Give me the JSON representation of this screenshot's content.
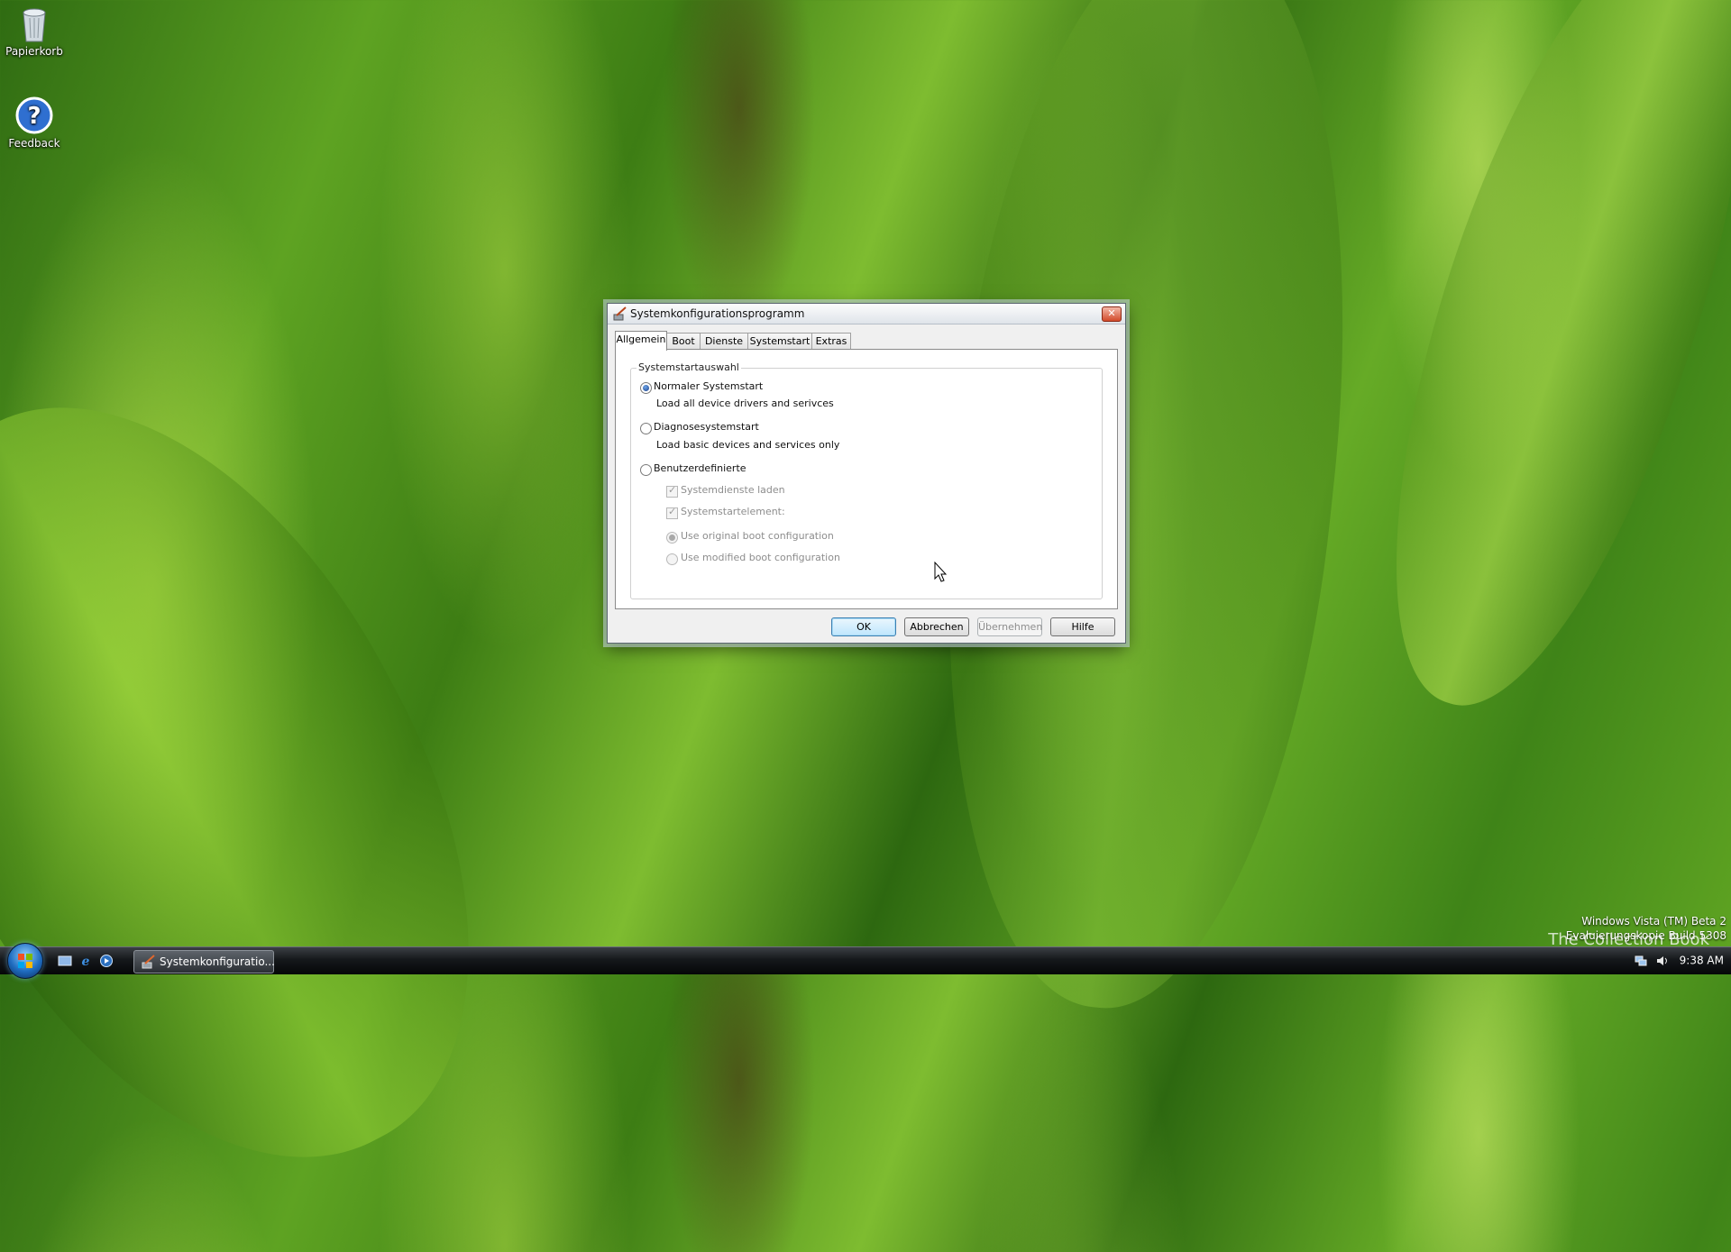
{
  "desktop": {
    "icons": [
      {
        "label": "Papierkorb",
        "icon": "recycle-bin-icon"
      },
      {
        "label": "Feedback",
        "icon": "help-question-icon"
      }
    ],
    "watermark": {
      "line1": "Windows Vista (TM) Beta 2",
      "line2": "Evaluierungskopie Build 5308"
    },
    "corner_text": "The Collection Book"
  },
  "dialog": {
    "title": "Systemkonfigurationsprogramm",
    "tabs": [
      {
        "label": "Allgemein",
        "active": true
      },
      {
        "label": "Boot",
        "active": false
      },
      {
        "label": "Dienste",
        "active": false
      },
      {
        "label": "Systemstart",
        "active": false
      },
      {
        "label": "Extras",
        "active": false
      }
    ],
    "group_title": "Systemstartauswahl",
    "options": {
      "normal": {
        "label": "Normaler Systemstart",
        "desc": "Load all device drivers and serivces",
        "selected": true
      },
      "diagnostic": {
        "label": "Diagnosesystemstart",
        "desc": "Load basic devices and services only",
        "selected": false
      },
      "custom": {
        "label": "Benutzerdefinierte",
        "selected": false
      }
    },
    "custom_options": {
      "load_services": {
        "label": "Systemdienste laden",
        "checked": true,
        "enabled": false
      },
      "startup_items": {
        "label": "Systemstartelement:",
        "checked": true,
        "enabled": false
      },
      "original_boot": {
        "label": "Use original boot configuration",
        "selected": true,
        "enabled": false
      },
      "modified_boot": {
        "label": "Use modified boot configuration",
        "selected": false,
        "enabled": false
      }
    },
    "buttons": {
      "ok": "OK",
      "cancel": "Abbrechen",
      "apply": "Übernehmen",
      "help": "Hilfe"
    },
    "close_symbol": "✕"
  },
  "taskbar": {
    "task_button_label": "Systemkonfiguratio...",
    "clock": "9:38 AM"
  },
  "colors": {
    "taskbar": "#15181b",
    "dialog_bg": "#f0f0f0",
    "default_button": "#bee6fd",
    "close_button": "#d24a2a"
  }
}
